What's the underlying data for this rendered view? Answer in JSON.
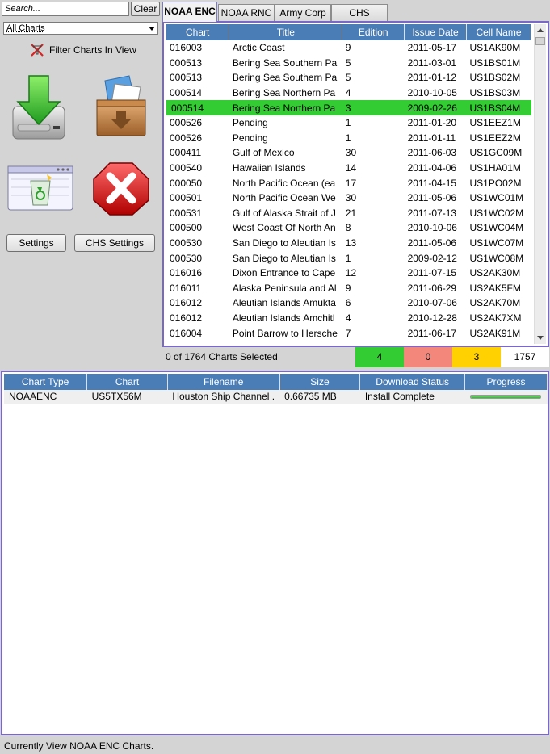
{
  "search": {
    "placeholder": "Search...",
    "value": ""
  },
  "toolbar": {
    "clear_label": "Clear",
    "filter_select": "All Charts",
    "filter_in_view_label": "Filter Charts In View",
    "settings_label": "Settings",
    "chs_settings_label": "CHS Settings"
  },
  "tabs": [
    {
      "label": "NOAA ENC",
      "active": true
    },
    {
      "label": "NOAA RNC",
      "active": false
    },
    {
      "label": "Army Corp",
      "active": false
    },
    {
      "label": "CHS",
      "active": false
    }
  ],
  "charts_table": {
    "columns": [
      "Chart",
      "Title",
      "Edition",
      "Issue Date",
      "Cell Name"
    ],
    "rows": [
      [
        "016003",
        "Arctic Coast",
        "9",
        "2011-05-17",
        "US1AK90M"
      ],
      [
        "000513",
        "Bering Sea Southern Pa",
        "5",
        "2011-03-01",
        "US1BS01M"
      ],
      [
        "000513",
        "Bering Sea Southern Pa",
        "5",
        "2011-01-12",
        "US1BS02M"
      ],
      [
        "000514",
        "Bering Sea Northern Pa",
        "4",
        "2010-10-05",
        "US1BS03M"
      ],
      [
        "000514",
        "Bering Sea Northern Pa",
        "3",
        "2009-02-26",
        "US1BS04M"
      ],
      [
        "000526",
        "Pending",
        "1",
        "2011-01-20",
        "US1EEZ1M"
      ],
      [
        "000526",
        "Pending",
        "1",
        "2011-01-11",
        "US1EEZ2M"
      ],
      [
        "000411",
        "Gulf of Mexico",
        "30",
        "2011-06-03",
        "US1GC09M"
      ],
      [
        "000540",
        "Hawaiian Islands",
        "14",
        "2011-04-06",
        "US1HA01M"
      ],
      [
        "000050",
        "North Pacific Ocean (ea",
        "17",
        "2011-04-15",
        "US1PO02M"
      ],
      [
        "000501",
        "North Pacific Ocean We",
        "30",
        "2011-05-06",
        "US1WC01M"
      ],
      [
        "000531",
        "Gulf of Alaska Strait of J",
        "21",
        "2011-07-13",
        "US1WC02M"
      ],
      [
        "000500",
        "West Coast Of North An",
        "8",
        "2010-10-06",
        "US1WC04M"
      ],
      [
        "000530",
        "San Diego to Aleutian Is",
        "13",
        "2011-05-06",
        "US1WC07M"
      ],
      [
        "000530",
        "San Diego to Aleutian Is",
        "1",
        "2009-02-12",
        "US1WC08M"
      ],
      [
        "016016",
        "Dixon Entrance to Cape",
        "12",
        "2011-07-15",
        "US2AK30M"
      ],
      [
        "016011",
        "Alaska Peninsula and Al",
        "9",
        "2011-06-29",
        "US2AK5FM"
      ],
      [
        "016012",
        "Aleutian Islands Amukta",
        "6",
        "2010-07-06",
        "US2AK70M"
      ],
      [
        "016012",
        "Aleutian Islands Amchitl",
        "4",
        "2010-12-28",
        "US2AK7XM"
      ],
      [
        "016004",
        "Point Barrow to Hersche",
        "7",
        "2011-06-17",
        "US2AK91M"
      ]
    ],
    "selected_row_index": 4
  },
  "status_counts": {
    "selected_text": "0 of 1764 Charts Selected",
    "green": "4",
    "red": "0",
    "yellow": "3",
    "total": "1757"
  },
  "downloads_table": {
    "columns": [
      "Chart Type",
      "Chart",
      "Filename",
      "Size",
      "Download Status",
      "Progress"
    ],
    "rows": [
      {
        "chart_type": "NOAAENC",
        "chart": "US5TX56M",
        "filename": "Houston Ship Channel .",
        "size": "0.66735 MB",
        "status": "Install Complete",
        "progress": 1.0
      }
    ]
  },
  "status_bar": {
    "text": "Currently View NOAA ENC Charts."
  },
  "colors": {
    "accent_border": "#7a68c8",
    "header_blue": "#4a7db5",
    "selected_green": "#33cc33",
    "count_red": "#f4877b",
    "count_yellow": "#ffd100"
  },
  "icons": [
    "download-disk-icon",
    "archive-box-icon",
    "recycle-bin-icon",
    "cancel-x-icon",
    "filter-x-icon"
  ]
}
